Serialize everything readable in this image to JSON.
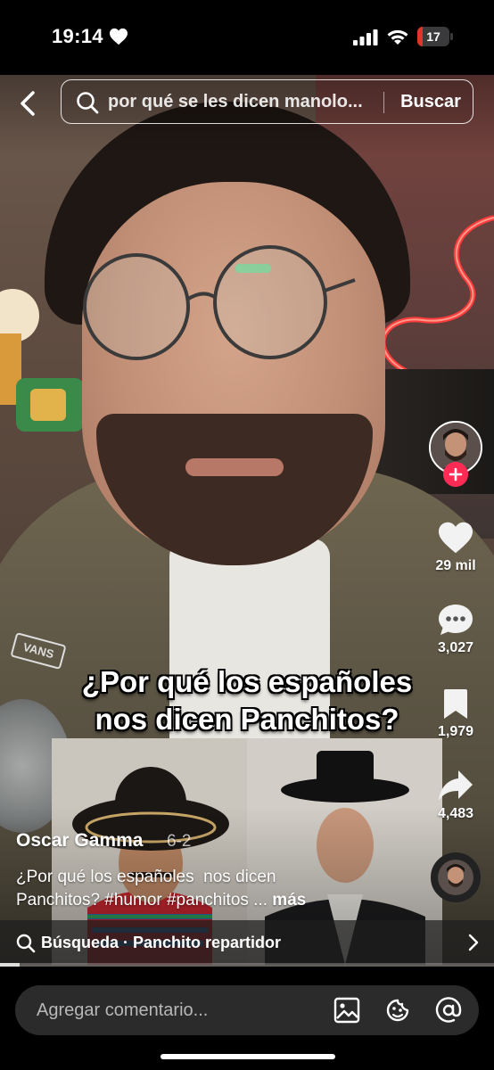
{
  "status_bar": {
    "time": "19:14",
    "battery": "17",
    "battery_level": 0.17,
    "battery_color": "#e0352b"
  },
  "search": {
    "query": "por qué se les dicen manolo...",
    "button_label": "Buscar"
  },
  "video": {
    "overlay_line1": "¿Por qué los españoles",
    "overlay_line2": "nos dicen Panchitos?",
    "sticker_text": "VANS"
  },
  "actions": {
    "likes": "29 mil",
    "comments": "3,027",
    "saves": "1,979",
    "shares": "4,483"
  },
  "post": {
    "author": "Oscar Gamma",
    "date": "6-2",
    "caption_line1": "¿Por qué los españoles  nos dicen",
    "caption_line2": "Panchitos? #humor #panchitos ...",
    "more_label": "más"
  },
  "suggestion": {
    "text": "Búsqueda · Panchito repartidor"
  },
  "playback": {
    "progress": 0.04
  },
  "comment_bar": {
    "placeholder": "Agregar comentario..."
  },
  "colors": {
    "accent": "#fe2c55",
    "neon": "#ff3b3b"
  },
  "icons": {
    "status": "heart-icon",
    "back": "chevron-left-icon",
    "search": "search-icon",
    "like": "heart-icon",
    "comment": "comment-bubble-icon",
    "save": "bookmark-icon",
    "share": "share-arrow-icon",
    "follow": "plus-icon",
    "image": "image-icon",
    "emoji": "emoji-icon",
    "mention": "at-icon"
  }
}
